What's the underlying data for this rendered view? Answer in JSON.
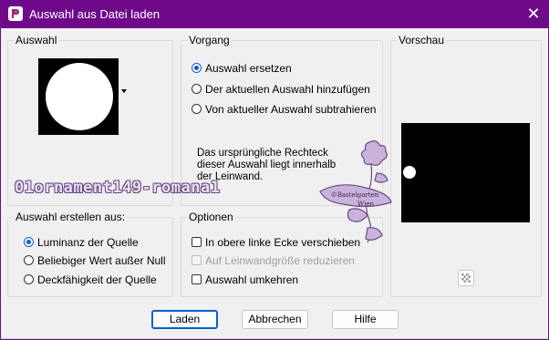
{
  "window": {
    "title": "Auswahl aus Datei laden",
    "close_glyph": "✕",
    "app_icon": "paintshop-icon"
  },
  "groups": {
    "auswahl": {
      "legend": "Auswahl"
    },
    "vorgang": {
      "legend": "Vorgang",
      "options": [
        {
          "label": "Auswahl ersetzen",
          "selected": true
        },
        {
          "label": "Der aktuellen Auswahl hinzufügen",
          "selected": false
        },
        {
          "label": "Von aktueller Auswahl subtrahieren",
          "selected": false
        }
      ],
      "info": "Das ursprüngliche Rechteck dieser Auswahl liegt innerhalb der Leinwand."
    },
    "vorschau": {
      "legend": "Vorschau"
    },
    "erstellen": {
      "legend": "Auswahl erstellen aus:",
      "options": [
        {
          "label": "Luminanz der Quelle",
          "selected": true
        },
        {
          "label": "Beliebiger Wert außer Null",
          "selected": false
        },
        {
          "label": "Deckfähigkeit der Quelle",
          "selected": false
        }
      ]
    },
    "optionen": {
      "legend": "Optionen",
      "checks": [
        {
          "label": "In obere linke Ecke verschieben",
          "checked": false,
          "enabled": true
        },
        {
          "label": "Auf Leinwandgröße reduzieren",
          "checked": false,
          "enabled": false
        },
        {
          "label": "Auswahl umkehren",
          "checked": false,
          "enabled": true
        }
      ]
    }
  },
  "watermark": {
    "name": "01ornament149-romana1",
    "ornament_text_1": "©Bastelgarten",
    "ornament_text_2": "Wien"
  },
  "buttons": {
    "load": "Laden",
    "cancel": "Abbrechen",
    "help": "Hilfe"
  },
  "colors": {
    "titlebar": "#6e0a8a",
    "accent": "#0a5fcc"
  }
}
